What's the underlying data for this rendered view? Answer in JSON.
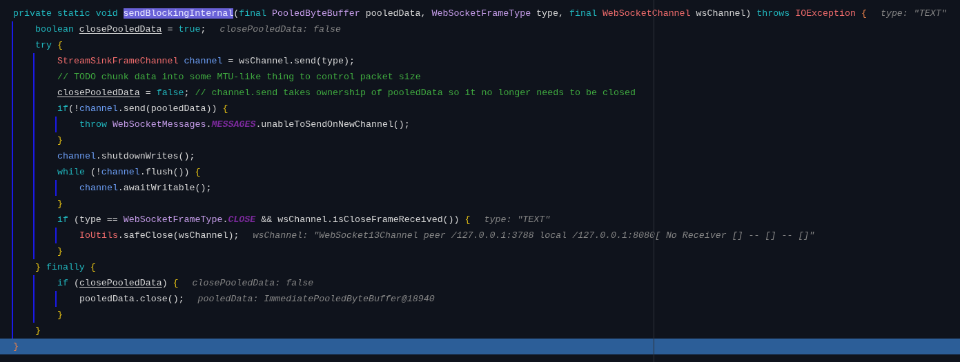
{
  "lines": [
    {
      "selected": false,
      "tokens": [
        {
          "kind": "keyword",
          "text": "private static void "
        },
        {
          "kind": "selected",
          "text": "sendBlockingInternal"
        },
        {
          "kind": "plain",
          "text": "("
        },
        {
          "kind": "keyword",
          "text": "final "
        },
        {
          "kind": "class",
          "text": "PooledByteBuffer "
        },
        {
          "kind": "plain",
          "text": "pooledData, "
        },
        {
          "kind": "class",
          "text": "WebSocketFrameType "
        },
        {
          "kind": "plain",
          "text": "type, "
        },
        {
          "kind": "keyword",
          "text": "final "
        },
        {
          "kind": "type",
          "text": "WebSocketChannel "
        },
        {
          "kind": "plain",
          "text": "wsChannel) "
        },
        {
          "kind": "keyword",
          "text": "throws "
        },
        {
          "kind": "type",
          "text": "IOException "
        },
        {
          "kind": "brace-outer",
          "text": "{"
        }
      ],
      "hint": "type: \"TEXT\"",
      "children": [
        {
          "selected": false,
          "tokens": [
            {
              "kind": "keyword",
              "text": "boolean "
            },
            {
              "kind": "var",
              "text": "closePooledData"
            },
            {
              "kind": "plain",
              "text": " = "
            },
            {
              "kind": "keyword",
              "text": "true"
            },
            {
              "kind": "plain",
              "text": ";"
            }
          ],
          "hint": "closePooledData: false"
        },
        {
          "selected": false,
          "tokens": [
            {
              "kind": "keyword",
              "text": "try "
            },
            {
              "kind": "brace",
              "text": "{"
            }
          ],
          "children": [
            {
              "selected": false,
              "tokens": [
                {
                  "kind": "type",
                  "text": "StreamSinkFrameChannel "
                },
                {
                  "kind": "field",
                  "text": "channel"
                },
                {
                  "kind": "plain",
                  "text": " = wsChannel.send(type);"
                }
              ]
            },
            {
              "selected": false,
              "tokens": [
                {
                  "kind": "comment",
                  "text": "// TODO chunk data into some MTU-like thing to control packet size"
                }
              ]
            },
            {
              "selected": false,
              "tokens": [
                {
                  "kind": "var",
                  "text": "closePooledData"
                },
                {
                  "kind": "plain",
                  "text": " = "
                },
                {
                  "kind": "keyword",
                  "text": "false"
                },
                {
                  "kind": "plain",
                  "text": "; "
                },
                {
                  "kind": "comment",
                  "text": "// channel.send takes ownership of pooledData so it no longer needs to be closed"
                }
              ]
            },
            {
              "selected": false,
              "tokens": [
                {
                  "kind": "keyword",
                  "text": "if"
                },
                {
                  "kind": "plain",
                  "text": "(!"
                },
                {
                  "kind": "field",
                  "text": "channel"
                },
                {
                  "kind": "plain",
                  "text": ".send(pooledData)) "
                },
                {
                  "kind": "brace",
                  "text": "{"
                }
              ],
              "children": [
                {
                  "selected": false,
                  "tokens": [
                    {
                      "kind": "keyword",
                      "text": "throw "
                    },
                    {
                      "kind": "class",
                      "text": "WebSocketMessages"
                    },
                    {
                      "kind": "plain",
                      "text": "."
                    },
                    {
                      "kind": "static",
                      "text": "MESSAGES"
                    },
                    {
                      "kind": "plain",
                      "text": ".unableToSendOnNewChannel();"
                    }
                  ]
                }
              ]
            },
            {
              "selected": false,
              "tokens": [
                {
                  "kind": "brace",
                  "text": "}"
                }
              ]
            },
            {
              "selected": false,
              "tokens": [
                {
                  "kind": "field",
                  "text": "channel"
                },
                {
                  "kind": "plain",
                  "text": ".shutdownWrites();"
                }
              ]
            },
            {
              "selected": false,
              "tokens": [
                {
                  "kind": "keyword",
                  "text": "while "
                },
                {
                  "kind": "plain",
                  "text": "(!"
                },
                {
                  "kind": "field",
                  "text": "channel"
                },
                {
                  "kind": "plain",
                  "text": ".flush()) "
                },
                {
                  "kind": "brace",
                  "text": "{"
                }
              ],
              "children": [
                {
                  "selected": false,
                  "tokens": [
                    {
                      "kind": "field",
                      "text": "channel"
                    },
                    {
                      "kind": "plain",
                      "text": ".awaitWritable();"
                    }
                  ]
                }
              ]
            },
            {
              "selected": false,
              "tokens": [
                {
                  "kind": "brace",
                  "text": "}"
                }
              ]
            },
            {
              "selected": false,
              "tokens": [
                {
                  "kind": "keyword",
                  "text": "if "
                },
                {
                  "kind": "plain",
                  "text": "(type == "
                },
                {
                  "kind": "class",
                  "text": "WebSocketFrameType"
                },
                {
                  "kind": "plain",
                  "text": "."
                },
                {
                  "kind": "static",
                  "text": "CLOSE"
                },
                {
                  "kind": "plain",
                  "text": " && wsChannel.isCloseFrameReceived()) "
                },
                {
                  "kind": "brace",
                  "text": "{"
                }
              ],
              "hint": "type: \"TEXT\"",
              "children": [
                {
                  "selected": false,
                  "tokens": [
                    {
                      "kind": "type",
                      "text": "IoUtils"
                    },
                    {
                      "kind": "plain",
                      "text": ".safeClose(wsChannel);"
                    }
                  ],
                  "hint": "wsChannel: \"WebSocket13Channel peer /127.0.0.1:3788 local /127.0.0.1:8080[ No Receiver [] -- [] -- []\""
                }
              ]
            },
            {
              "selected": false,
              "tokens": [
                {
                  "kind": "brace",
                  "text": "}"
                }
              ]
            }
          ]
        },
        {
          "selected": false,
          "tokens": [
            {
              "kind": "brace",
              "text": "} "
            },
            {
              "kind": "keyword",
              "text": "finally "
            },
            {
              "kind": "brace",
              "text": "{"
            }
          ],
          "children": [
            {
              "selected": false,
              "tokens": [
                {
                  "kind": "keyword",
                  "text": "if "
                },
                {
                  "kind": "plain",
                  "text": "("
                },
                {
                  "kind": "var",
                  "text": "closePooledData"
                },
                {
                  "kind": "plain",
                  "text": ") "
                },
                {
                  "kind": "brace",
                  "text": "{"
                }
              ],
              "hint": "closePooledData: false",
              "children": [
                {
                  "selected": false,
                  "tokens": [
                    {
                      "kind": "plain",
                      "text": "pooledData.close();"
                    }
                  ],
                  "hint": "pooledData: ImmediatePooledByteBuffer@18940"
                }
              ]
            },
            {
              "selected": false,
              "tokens": [
                {
                  "kind": "brace",
                  "text": "}"
                }
              ]
            }
          ]
        },
        {
          "selected": false,
          "tokens": [
            {
              "kind": "brace",
              "text": "}"
            }
          ]
        }
      ]
    },
    {
      "selected": true,
      "tokens": [
        {
          "kind": "brace-outer",
          "text": "}"
        }
      ]
    }
  ]
}
